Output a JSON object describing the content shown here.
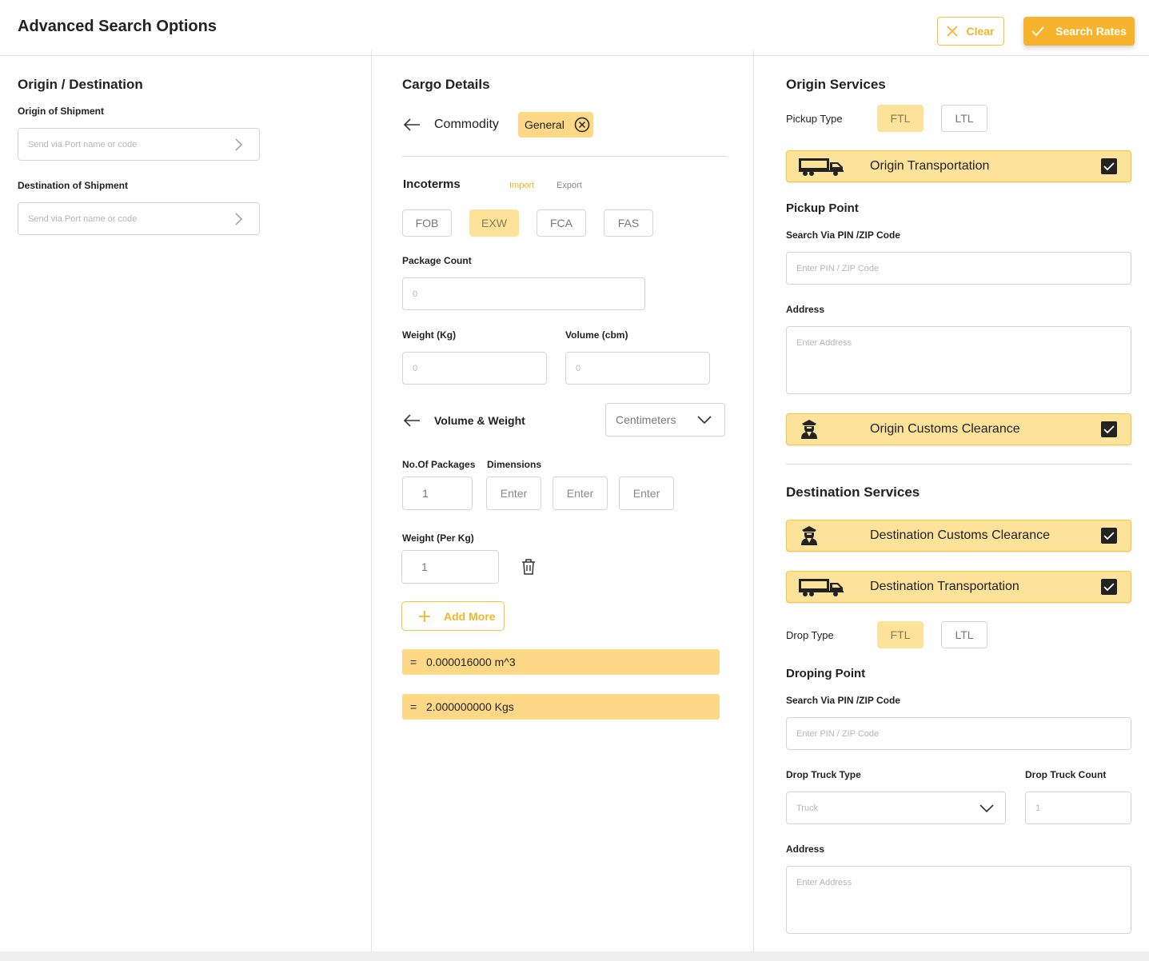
{
  "header": {
    "title": "Advanced Search Options",
    "clear_label": "Clear",
    "search_label": "Search Rates"
  },
  "origin_destination": {
    "title": "Origin / Destination",
    "origin_label": "Origin of Shipment",
    "origin_placeholder": "Send via  Port name or code",
    "destination_label": "Destination of Shipment",
    "destination_placeholder": "Send via  Port name or code"
  },
  "cargo": {
    "title": "Cargo Details",
    "commodity_label": "Commodity",
    "commodity_tag": "General",
    "incoterms_label": "Incoterms",
    "import_label": "Import",
    "export_label": "Export",
    "incoterms": [
      "FOB",
      "EXW",
      "FCA",
      "FAS"
    ],
    "selected_incoterm": "EXW",
    "package_count_label": "Package Count",
    "package_count_placeholder": "0",
    "weight_label": "Weight (Kg)",
    "weight_placeholder": "0",
    "volume_label": "Volume (cbm)",
    "volume_placeholder": "0",
    "volume_weight_label": "Volume & Weight",
    "unit_select": "Centimeters",
    "packages_label": "No.Of Packages",
    "packages_value": "1",
    "dimensions_label": "Dimensions",
    "dim_placeholders": [
      "Enter",
      "Enter",
      "Enter"
    ],
    "weight_per_label": "Weight (Per Kg)",
    "weight_per_value": "1",
    "add_more_label": "Add More",
    "result_eq": "=",
    "result_volume": "0.000016000  m^3",
    "result_weight": "2.000000000  Kgs"
  },
  "origin_services": {
    "title": "Origin Services",
    "pickup_type_label": "Pickup Type",
    "pickup_types": [
      "FTL",
      "LTL"
    ],
    "selected_pickup_type": "FTL",
    "transport_label": "Origin Transportation",
    "transport_checked": true,
    "pickup_point_title": "Pickup Point",
    "pin_label": "Search Via PIN /ZIP Code",
    "pin_placeholder": "Enter PIN / ZIP Code",
    "address_label": "Address",
    "address_placeholder": "Enter Address",
    "customs_label": "Origin Customs Clearance",
    "customs_checked": true
  },
  "destination_services": {
    "title": "Destination Services",
    "customs_label": "Destination Customs Clearance",
    "customs_checked": true,
    "transport_label": "Destination Transportation",
    "transport_checked": true,
    "drop_type_label": "Drop Type",
    "drop_types": [
      "FTL",
      "LTL"
    ],
    "selected_drop_type": "FTL",
    "droping_point_title": "Droping Point",
    "pin_label": "Search Via PIN /ZIP Code",
    "pin_placeholder": "Enter PIN / ZIP Code",
    "truck_type_label": "Drop Truck Type",
    "truck_type_placeholder": "Truck",
    "truck_count_label": "Drop Truck Count",
    "truck_count_placeholder": "1",
    "address_label": "Address",
    "address_placeholder": "Enter Address"
  },
  "colors": {
    "accent": "#f7b32b",
    "accent_light": "#fde29a",
    "result_bar": "#fdd987"
  }
}
